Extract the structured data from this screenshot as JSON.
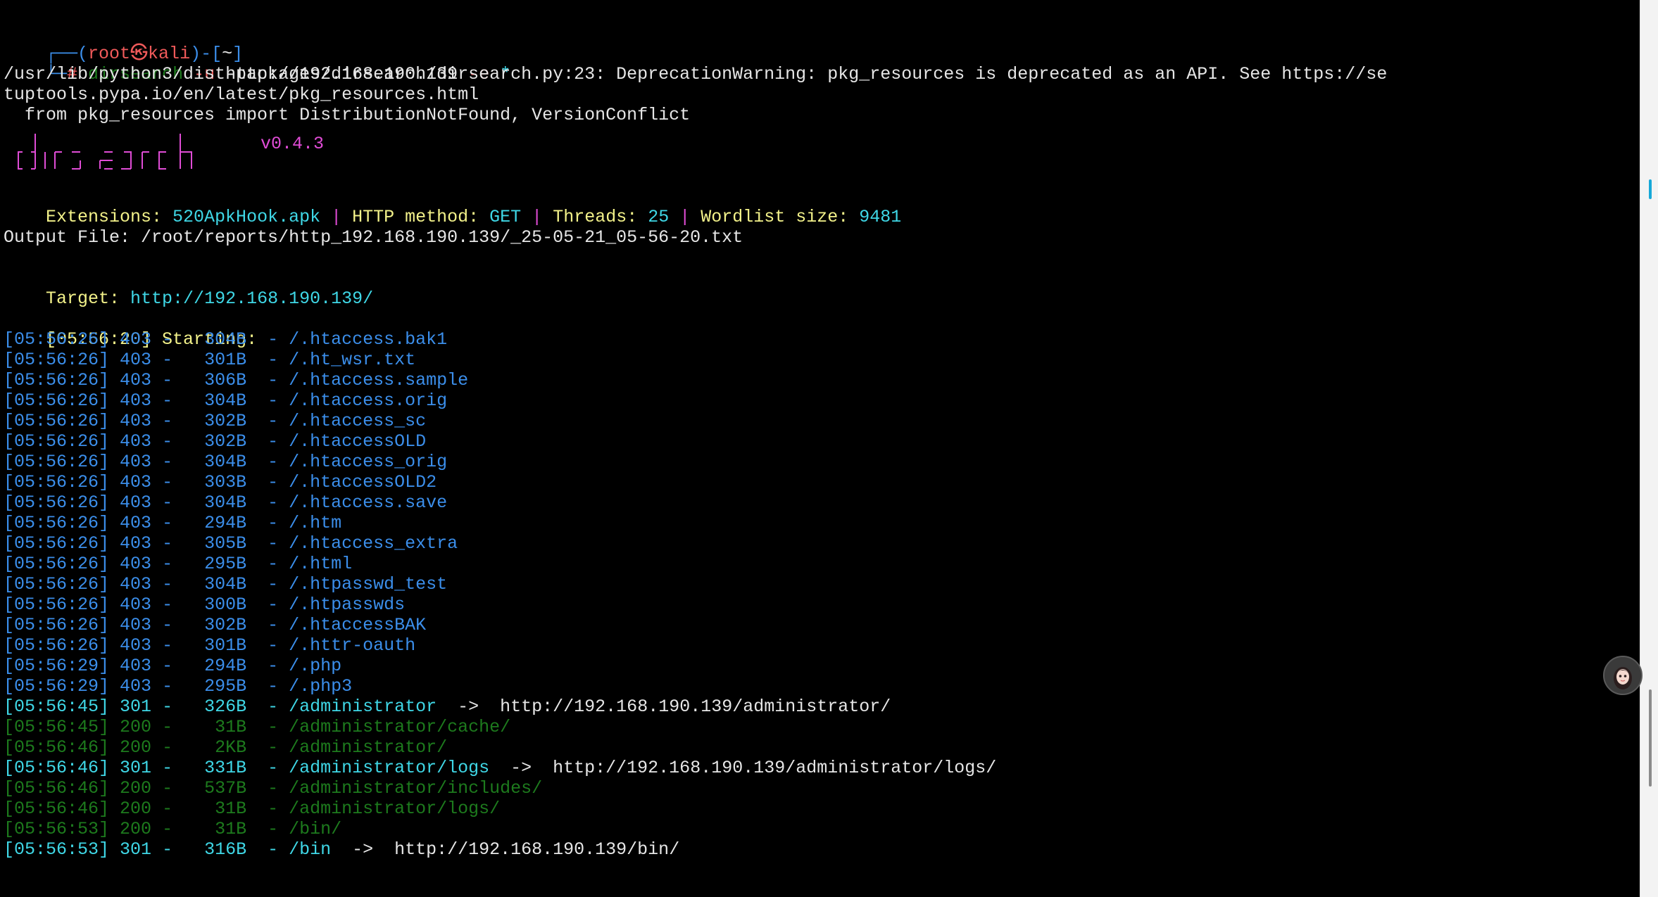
{
  "prompt": {
    "corner_top": "┌──",
    "open_paren": "(",
    "user_host": "root㉿kali",
    "close_paren": ")",
    "dash": "-",
    "dir_open": "[",
    "dir": "~",
    "dir_close": "]",
    "corner_bottom": "└─",
    "hash": "# ",
    "cmd": "dirsearch",
    "flag_u": "-u",
    "url": "http://192.168.190.139",
    "flag_e": "-e",
    "ext": "*"
  },
  "warning": {
    "line1": "/usr/lib/python3/dist-packages/dirsearch/dirsearch.py:23: DeprecationWarning: pkg_resources is deprecated as an API. See https://se",
    "line2": "tuptools.pypa.io/en/latest/pkg_resources.html",
    "line3": "  from pkg_resources import DistributionNotFound, VersionConflict"
  },
  "banner": {
    "logo_text": "dirsearch",
    "version": "v0.4.3"
  },
  "config": {
    "extensions_label": "Extensions: ",
    "extensions_value": "520ApkHook.apk",
    "sep1": " | ",
    "method_label": "HTTP method: ",
    "method_value": "GET",
    "sep2": " | ",
    "threads_label": "Threads: ",
    "threads_value": "25",
    "sep3": " | ",
    "wordlist_label": "Wordlist size: ",
    "wordlist_value": "9481"
  },
  "output_file": "Output File: /root/reports/http_192.168.190.139/_25-05-21_05-56-20.txt",
  "target": {
    "label": "Target: ",
    "url": "http://192.168.190.139/"
  },
  "start": {
    "time": "[05:56:20]",
    "label": " Starting:"
  },
  "results": [
    {
      "time": "[05:56:26]",
      "code": "403",
      "size": "304B",
      "path": "/.htaccess.bak1",
      "redirect": "",
      "color": "#3b8eea"
    },
    {
      "time": "[05:56:26]",
      "code": "403",
      "size": "301B",
      "path": "/.ht_wsr.txt",
      "redirect": "",
      "color": "#3b8eea"
    },
    {
      "time": "[05:56:26]",
      "code": "403",
      "size": "306B",
      "path": "/.htaccess.sample",
      "redirect": "",
      "color": "#3b8eea"
    },
    {
      "time": "[05:56:26]",
      "code": "403",
      "size": "304B",
      "path": "/.htaccess.orig",
      "redirect": "",
      "color": "#3b8eea"
    },
    {
      "time": "[05:56:26]",
      "code": "403",
      "size": "302B",
      "path": "/.htaccess_sc",
      "redirect": "",
      "color": "#3b8eea"
    },
    {
      "time": "[05:56:26]",
      "code": "403",
      "size": "302B",
      "path": "/.htaccessOLD",
      "redirect": "",
      "color": "#3b8eea"
    },
    {
      "time": "[05:56:26]",
      "code": "403",
      "size": "304B",
      "path": "/.htaccess_orig",
      "redirect": "",
      "color": "#3b8eea"
    },
    {
      "time": "[05:56:26]",
      "code": "403",
      "size": "303B",
      "path": "/.htaccessOLD2",
      "redirect": "",
      "color": "#3b8eea"
    },
    {
      "time": "[05:56:26]",
      "code": "403",
      "size": "304B",
      "path": "/.htaccess.save",
      "redirect": "",
      "color": "#3b8eea"
    },
    {
      "time": "[05:56:26]",
      "code": "403",
      "size": "294B",
      "path": "/.htm",
      "redirect": "",
      "color": "#3b8eea"
    },
    {
      "time": "[05:56:26]",
      "code": "403",
      "size": "305B",
      "path": "/.htaccess_extra",
      "redirect": "",
      "color": "#3b8eea"
    },
    {
      "time": "[05:56:26]",
      "code": "403",
      "size": "295B",
      "path": "/.html",
      "redirect": "",
      "color": "#3b8eea"
    },
    {
      "time": "[05:56:26]",
      "code": "403",
      "size": "304B",
      "path": "/.htpasswd_test",
      "redirect": "",
      "color": "#3b8eea"
    },
    {
      "time": "[05:56:26]",
      "code": "403",
      "size": "300B",
      "path": "/.htpasswds",
      "redirect": "",
      "color": "#3b8eea"
    },
    {
      "time": "[05:56:26]",
      "code": "403",
      "size": "302B",
      "path": "/.htaccessBAK",
      "redirect": "",
      "color": "#3b8eea"
    },
    {
      "time": "[05:56:26]",
      "code": "403",
      "size": "301B",
      "path": "/.httr-oauth",
      "redirect": "",
      "color": "#3b8eea"
    },
    {
      "time": "[05:56:29]",
      "code": "403",
      "size": "294B",
      "path": "/.php",
      "redirect": "",
      "color": "#3b8eea"
    },
    {
      "time": "[05:56:29]",
      "code": "403",
      "size": "295B",
      "path": "/.php3",
      "redirect": "",
      "color": "#3b8eea"
    },
    {
      "time": "[05:56:45]",
      "code": "301",
      "size": "326B",
      "path": "/administrator",
      "redirect": "http://192.168.190.139/administrator/",
      "color": "#3fd7e6"
    },
    {
      "time": "[05:56:45]",
      "code": "200",
      "size": " 31B",
      "path": "/administrator/cache/",
      "redirect": "",
      "color": "#1d7a1d"
    },
    {
      "time": "[05:56:46]",
      "code": "200",
      "size": "  2KB",
      "path": "/administrator/",
      "redirect": "",
      "color": "#1d7a1d"
    },
    {
      "time": "[05:56:46]",
      "code": "301",
      "size": "331B",
      "path": "/administrator/logs",
      "redirect": "http://192.168.190.139/administrator/logs/",
      "color": "#3fd7e6"
    },
    {
      "time": "[05:56:46]",
      "code": "200",
      "size": "537B",
      "path": "/administrator/includes/",
      "redirect": "",
      "color": "#1d7a1d"
    },
    {
      "time": "[05:56:46]",
      "code": "200",
      "size": " 31B",
      "path": "/administrator/logs/",
      "redirect": "",
      "color": "#1d7a1d"
    },
    {
      "time": "[05:56:53]",
      "code": "200",
      "size": " 31B",
      "path": "/bin/",
      "redirect": "",
      "color": "#1d7a1d"
    },
    {
      "time": "[05:56:53]",
      "code": "301",
      "size": "316B",
      "path": "/bin",
      "redirect": "http://192.168.190.139/bin/",
      "color": "#3fd7e6"
    }
  ],
  "colors": {
    "background": "#000000",
    "forbidden": "#3b8eea",
    "redirect": "#3fd7e6",
    "ok": "#1d7a1d",
    "accent": "#f3f28a",
    "logo": "#e04cd6"
  }
}
